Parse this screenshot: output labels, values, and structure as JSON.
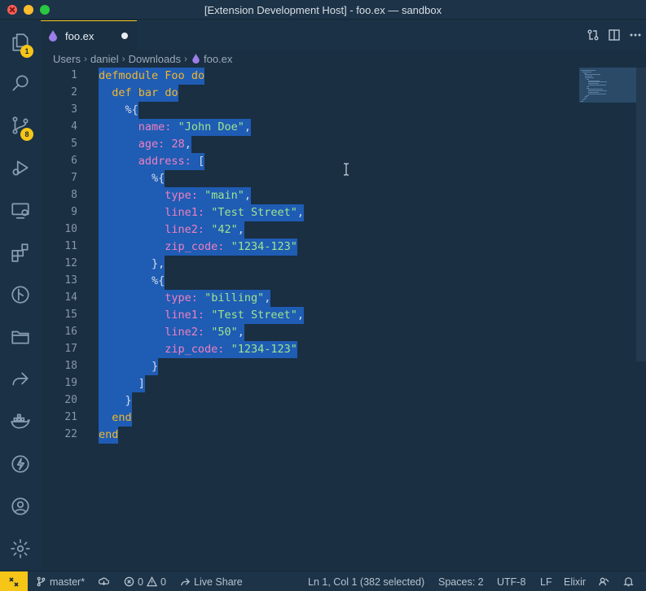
{
  "window": {
    "title": "[Extension Development Host] - foo.ex — sandbox"
  },
  "activity_bar": {
    "items": [
      {
        "icon": "files-icon",
        "badge": "1"
      },
      {
        "icon": "search-icon"
      },
      {
        "icon": "source-control-icon",
        "badge": "8"
      },
      {
        "icon": "run-debug-icon"
      },
      {
        "icon": "remote-explorer-icon"
      },
      {
        "icon": "extensions-icon"
      },
      {
        "icon": "git-graph-icon"
      },
      {
        "icon": "folder-icon"
      },
      {
        "icon": "live-share-icon"
      },
      {
        "icon": "docker-icon"
      },
      {
        "icon": "lightning-icon"
      },
      {
        "icon": "account-icon"
      },
      {
        "icon": "gear-icon"
      }
    ]
  },
  "tab": {
    "label": "foo.ex",
    "dirty": true,
    "icon": "elixir-drop-icon",
    "icon_color": "#9b7ee8"
  },
  "breadcrumb": [
    "Users",
    "daniel",
    "Downloads",
    "foo.ex"
  ],
  "editor": {
    "line_numbers": [
      "1",
      "2",
      "3",
      "4",
      "5",
      "6",
      "7",
      "8",
      "9",
      "10",
      "11",
      "12",
      "13",
      "14",
      "15",
      "16",
      "17",
      "18",
      "19",
      "20",
      "21",
      "22"
    ],
    "lines": [
      [
        [
          "kw",
          "defmodule"
        ],
        [
          "pun",
          " "
        ],
        [
          "kw",
          "Foo"
        ],
        [
          "pun",
          " "
        ],
        [
          "kw",
          "do"
        ]
      ],
      [
        [
          "pun",
          "  "
        ],
        [
          "kw",
          "def"
        ],
        [
          "pun",
          " "
        ],
        [
          "kw",
          "bar"
        ],
        [
          "pun",
          " "
        ],
        [
          "kw",
          "do"
        ]
      ],
      [
        [
          "pun",
          "    %{"
        ]
      ],
      [
        [
          "pun",
          "      "
        ],
        [
          "key",
          "name:"
        ],
        [
          "pun",
          " "
        ],
        [
          "str",
          "\"John Doe\""
        ],
        [
          "pun",
          ","
        ]
      ],
      [
        [
          "pun",
          "      "
        ],
        [
          "key",
          "age:"
        ],
        [
          "pun",
          " "
        ],
        [
          "num",
          "28"
        ],
        [
          "pun",
          ","
        ]
      ],
      [
        [
          "pun",
          "      "
        ],
        [
          "key",
          "address:"
        ],
        [
          "pun",
          " ["
        ]
      ],
      [
        [
          "pun",
          "        %{"
        ]
      ],
      [
        [
          "pun",
          "          "
        ],
        [
          "key",
          "type:"
        ],
        [
          "pun",
          " "
        ],
        [
          "str",
          "\"main\""
        ],
        [
          "pun",
          ","
        ]
      ],
      [
        [
          "pun",
          "          "
        ],
        [
          "key",
          "line1:"
        ],
        [
          "pun",
          " "
        ],
        [
          "str",
          "\"Test Street\""
        ],
        [
          "pun",
          ","
        ]
      ],
      [
        [
          "pun",
          "          "
        ],
        [
          "key",
          "line2:"
        ],
        [
          "pun",
          " "
        ],
        [
          "str",
          "\"42\""
        ],
        [
          "pun",
          ","
        ]
      ],
      [
        [
          "pun",
          "          "
        ],
        [
          "key",
          "zip_code:"
        ],
        [
          "pun",
          " "
        ],
        [
          "str",
          "\"1234-123\""
        ]
      ],
      [
        [
          "pun",
          "        },"
        ]
      ],
      [
        [
          "pun",
          "        %{"
        ]
      ],
      [
        [
          "pun",
          "          "
        ],
        [
          "key",
          "type:"
        ],
        [
          "pun",
          " "
        ],
        [
          "str",
          "\"billing\""
        ],
        [
          "pun",
          ","
        ]
      ],
      [
        [
          "pun",
          "          "
        ],
        [
          "key",
          "line1:"
        ],
        [
          "pun",
          " "
        ],
        [
          "str",
          "\"Test Street\""
        ],
        [
          "pun",
          ","
        ]
      ],
      [
        [
          "pun",
          "          "
        ],
        [
          "key",
          "line2:"
        ],
        [
          "pun",
          " "
        ],
        [
          "str",
          "\"50\""
        ],
        [
          "pun",
          ","
        ]
      ],
      [
        [
          "pun",
          "          "
        ],
        [
          "key",
          "zip_code:"
        ],
        [
          "pun",
          " "
        ],
        [
          "str",
          "\"1234-123\""
        ]
      ],
      [
        [
          "pun",
          "        }"
        ]
      ],
      [
        [
          "pun",
          "      ]"
        ]
      ],
      [
        [
          "pun",
          "    }"
        ]
      ],
      [
        [
          "pun",
          "  "
        ],
        [
          "kw",
          "end"
        ]
      ],
      [
        [
          "kw",
          "end"
        ]
      ]
    ],
    "selection_color": "#1f5cb4"
  },
  "status_bar": {
    "branch": "master*",
    "errors": "0",
    "warnings": "0",
    "live_share": "Live Share",
    "position": "Ln 1, Col 1 (382 selected)",
    "indent": "Spaces: 2",
    "encoding": "UTF-8",
    "eol": "LF",
    "language": "Elixir"
  },
  "colors": {
    "accent": "#f5c518",
    "background": "#1a2f42"
  }
}
